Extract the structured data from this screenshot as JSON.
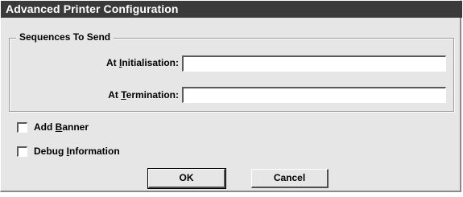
{
  "window": {
    "title": "Advanced Printer Configuration"
  },
  "sequences": {
    "group_label": "Sequences To Send",
    "initialisation": {
      "label_pre": "At ",
      "label_key": "I",
      "label_post": "nitialisation:",
      "value": ""
    },
    "termination": {
      "label_pre": "At ",
      "label_key": "T",
      "label_post": "ermination:",
      "value": ""
    }
  },
  "options": {
    "add_banner": {
      "label_pre": "Add ",
      "label_key": "B",
      "label_post": "anner",
      "checked": false
    },
    "debug_information": {
      "label_pre": "Debug ",
      "label_key": "I",
      "label_post": "nformation",
      "checked": false
    }
  },
  "buttons": {
    "ok": "OK",
    "cancel": "Cancel"
  }
}
